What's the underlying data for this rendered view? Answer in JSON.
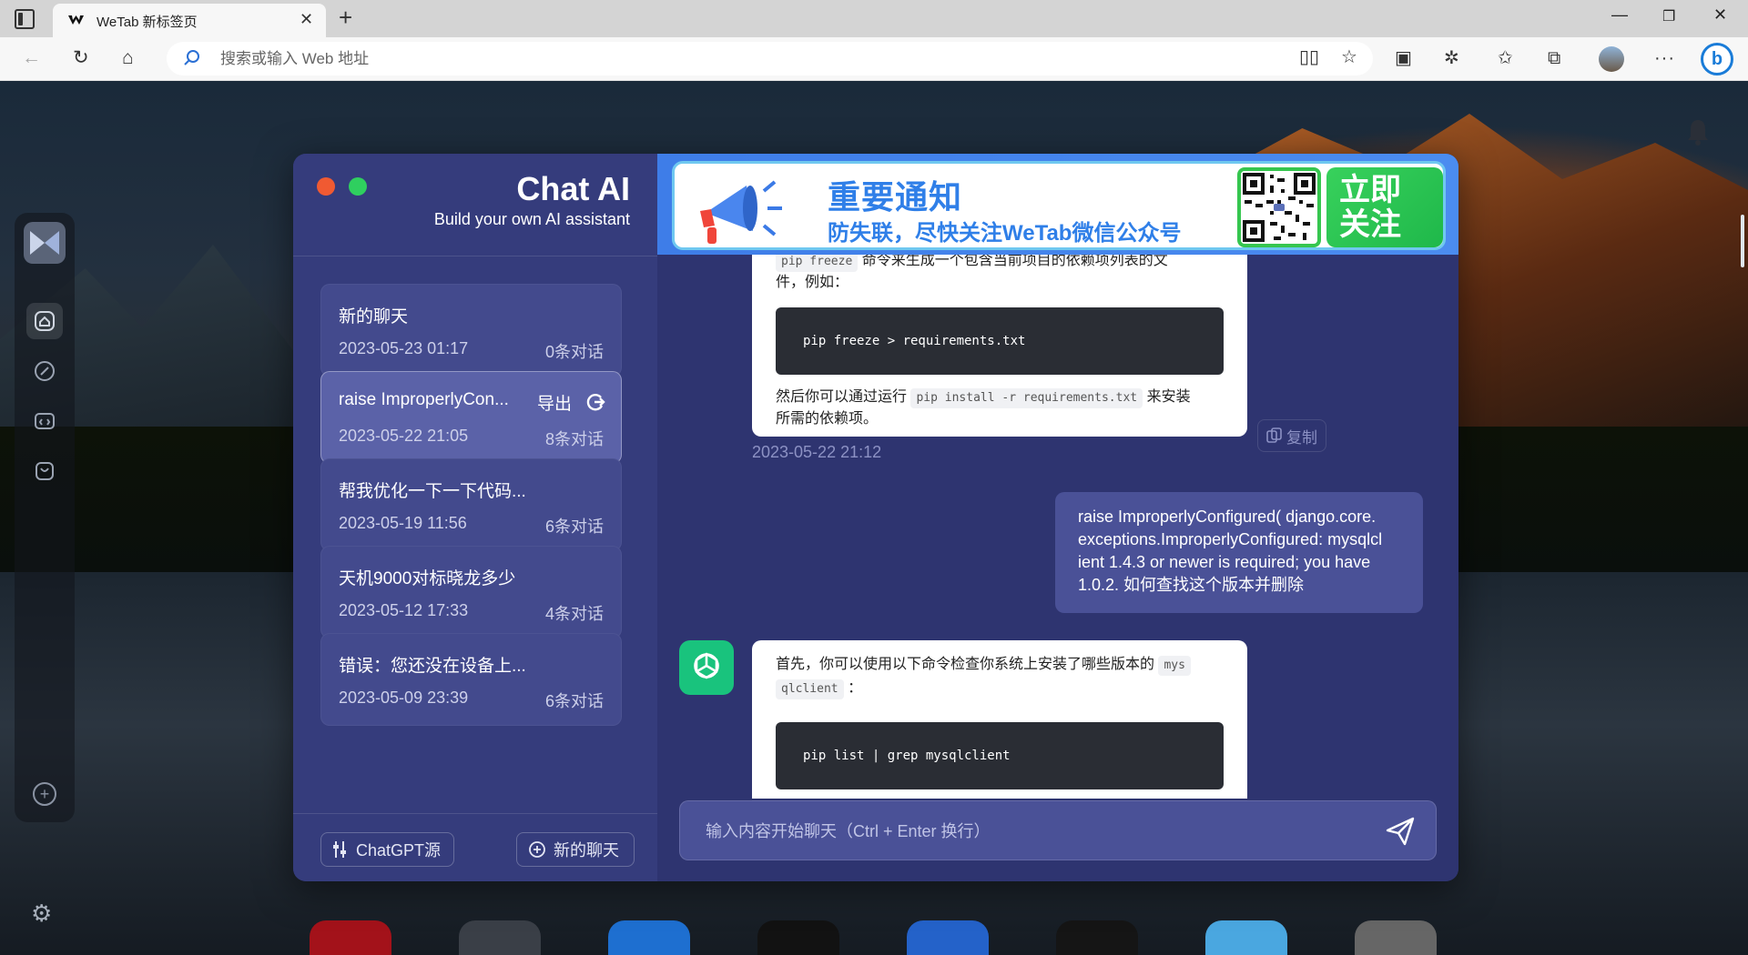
{
  "browser": {
    "tab_title": "WeTab 新标签页",
    "address_placeholder": "搜索或输入 Web 地址"
  },
  "app": {
    "title": "Chat AI",
    "subtitle": "Build your own AI assistant"
  },
  "chats": [
    {
      "title": "新的聊天",
      "date": "2023-05-23 01:17",
      "count": "0条对话"
    },
    {
      "title": "raise ImproperlyCon...",
      "date": "2023-05-22 21:05",
      "count": "8条对话",
      "export": "导出"
    },
    {
      "title": "帮我优化一下一下代码...",
      "date": "2023-05-19 11:56",
      "count": "6条对话"
    },
    {
      "title": "天机9000对标晓龙多少",
      "date": "2023-05-12 17:33",
      "count": "4条对话"
    },
    {
      "title": "错误：您还没在设备上...",
      "date": "2023-05-09 23:39",
      "count": "6条对话"
    }
  ],
  "footer": {
    "source_label": "ChatGPT源",
    "new_chat_label": "新的聊天"
  },
  "banner": {
    "title": "重要通知",
    "subtitle": "防失联，尽快关注WeTab微信公众号",
    "follow_line1": "立即",
    "follow_line2": "关注"
  },
  "messages": {
    "ai1": {
      "top_code": "pip freeze",
      "top_text": "命令来生成一个包含当前项目的依赖项列表的文",
      "line2": "件，例如：",
      "code": "pip freeze > requirements.txt",
      "after_prefix": "然后你可以通过运行",
      "after_code": "pip install -r requirements.txt",
      "after_suffix": "来安装",
      "after_line2": "所需的依赖项。",
      "copy": "复制",
      "time": "2023-05-22 21:12"
    },
    "user1": {
      "text": "raise ImproperlyConfigured( django.core.exceptions.ImproperlyConfigured: mysqlclient 1.4.3 or newer is required; you have 1.0.2. 如何查找这个版本并删除",
      "line1": "raise ImproperlyConfigured( django.core.",
      "line2": "exceptions.ImproperlyConfigured: mysqlcl",
      "line3": "ient 1.4.3 or newer is required; you have",
      "line4": "1.0.2. 如何查找这个版本并删除"
    },
    "ai2": {
      "intro": "首先，你可以使用以下命令检查你系统上安装了哪些版本的",
      "inline1": "mys",
      "inline2": "qlclient",
      "colon": "：",
      "code": "pip list | grep mysqlclient"
    }
  },
  "input": {
    "placeholder": "输入内容开始聊天（Ctrl + Enter 换行）"
  },
  "colors": {
    "sidebar": "#353c7c",
    "main": "#2e3470",
    "selected_chat": "#5b62a8",
    "dot_red": "#f05a32",
    "dot_green": "#2fcf5f",
    "openai_green": "#19c37d",
    "banner_blue": "#2f7fe8"
  }
}
